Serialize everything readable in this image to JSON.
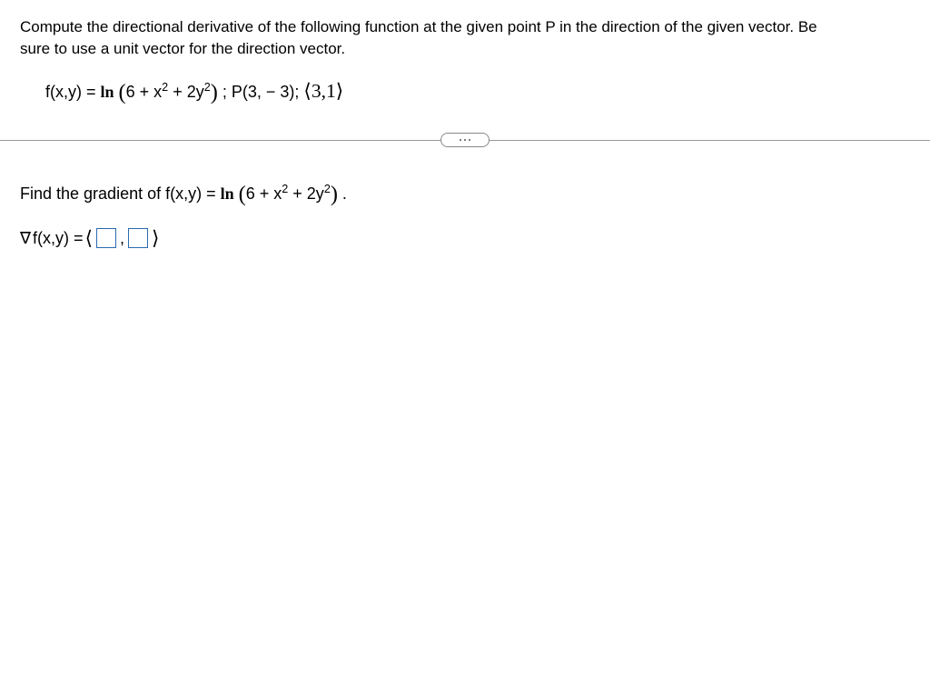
{
  "problem": {
    "statement_1": "Compute the directional derivative of the following function at the given point P in the direction of the given vector. Be",
    "statement_2": "sure to use a unit vector for the direction vector.",
    "func_prefix": "f(x,y) = ",
    "ln": "ln",
    "expr_inner": "6 + x",
    "expr_mid": " + 2y",
    "point_label": "; P(3, − 3); ",
    "vector": "⟨3,1⟩"
  },
  "question": {
    "prefix": "Find the gradient of f(x,y) = ",
    "ln": "ln",
    "expr_inner": "6 + x",
    "expr_mid": " + 2y",
    "period": " ."
  },
  "answer": {
    "nabla": "∇",
    "label": "f(x,y) = ",
    "comma": ","
  }
}
